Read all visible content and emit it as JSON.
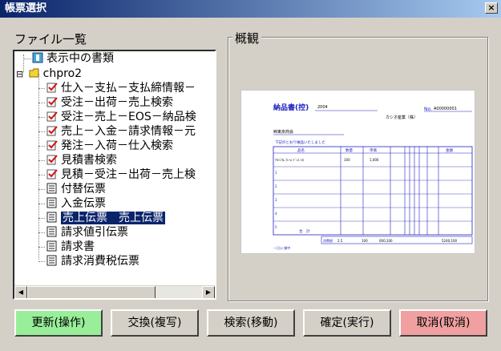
{
  "window": {
    "title": "帳票選択",
    "close": "×"
  },
  "file_list_label": "ファイル一覧",
  "preview_label": "概観",
  "tree": {
    "items": [
      {
        "label": "表示中の書類",
        "icon": "view-doc-icon"
      },
      {
        "label": "chpro2",
        "icon": "folder-icon"
      },
      {
        "label": "仕入－支払－支払締情報－",
        "icon": "checklist-icon"
      },
      {
        "label": "受注－出荷－売上検索",
        "icon": "checklist-icon"
      },
      {
        "label": "受注－売上－EOS－納品検",
        "icon": "checklist-icon"
      },
      {
        "label": "売上－入金－請求情報－元",
        "icon": "checklist-icon"
      },
      {
        "label": "発注－入荷－仕入検索",
        "icon": "checklist-icon"
      },
      {
        "label": "見積書検索",
        "icon": "checklist-icon"
      },
      {
        "label": "見積－受注－出荷－売上検",
        "icon": "checklist-icon"
      },
      {
        "label": "付替伝票",
        "icon": "slip-icon"
      },
      {
        "label": "入金伝票",
        "icon": "slip-icon"
      },
      {
        "label": "売上伝票　売上伝票",
        "icon": "slip-icon"
      },
      {
        "label": "請求値引伝票",
        "icon": "slip-icon"
      },
      {
        "label": "請求書",
        "icon": "slip-icon"
      },
      {
        "label": "請求消費税伝票",
        "icon": "slip-icon"
      }
    ],
    "expand_toggle": "⊟"
  },
  "preview": {
    "doc_title": "納品書(控)",
    "date_prefix": "2004",
    "slip_no_label": "No.",
    "slip_no": "A00000001",
    "company": "カシオ産業（株）",
    "customer": "㈱東京商会",
    "greeting": "下記のとおり納品いたしました",
    "headers": [
      "品名",
      "数量",
      "単価",
      "金額"
    ],
    "first_item": "ｱﾙﾐﾆｳﾑ ﾌﾚｰﾑ ﾄﾞﾚｽ ｼﾛ",
    "first_qty": "100",
    "first_price": "1,000",
    "row_nums": [
      "1",
      "2",
      "3",
      "4",
      "5"
    ],
    "total_label": "合　計",
    "tax_label": "消費税",
    "total_values": [
      "2.5",
      "100",
      "000,100",
      "5240,100"
    ],
    "footer": "一日公 御中"
  },
  "buttons": {
    "update": "更新(操作)",
    "exchange": "交換(複写)",
    "search": "検索(移動)",
    "confirm": "確定(実行)",
    "cancel": "取消(取消)"
  },
  "colors": {
    "title_bar": "#0a246a",
    "update_button": "#99ee99",
    "cancel_button": "#f0a0a0",
    "doc_blue": "#2020c0"
  }
}
